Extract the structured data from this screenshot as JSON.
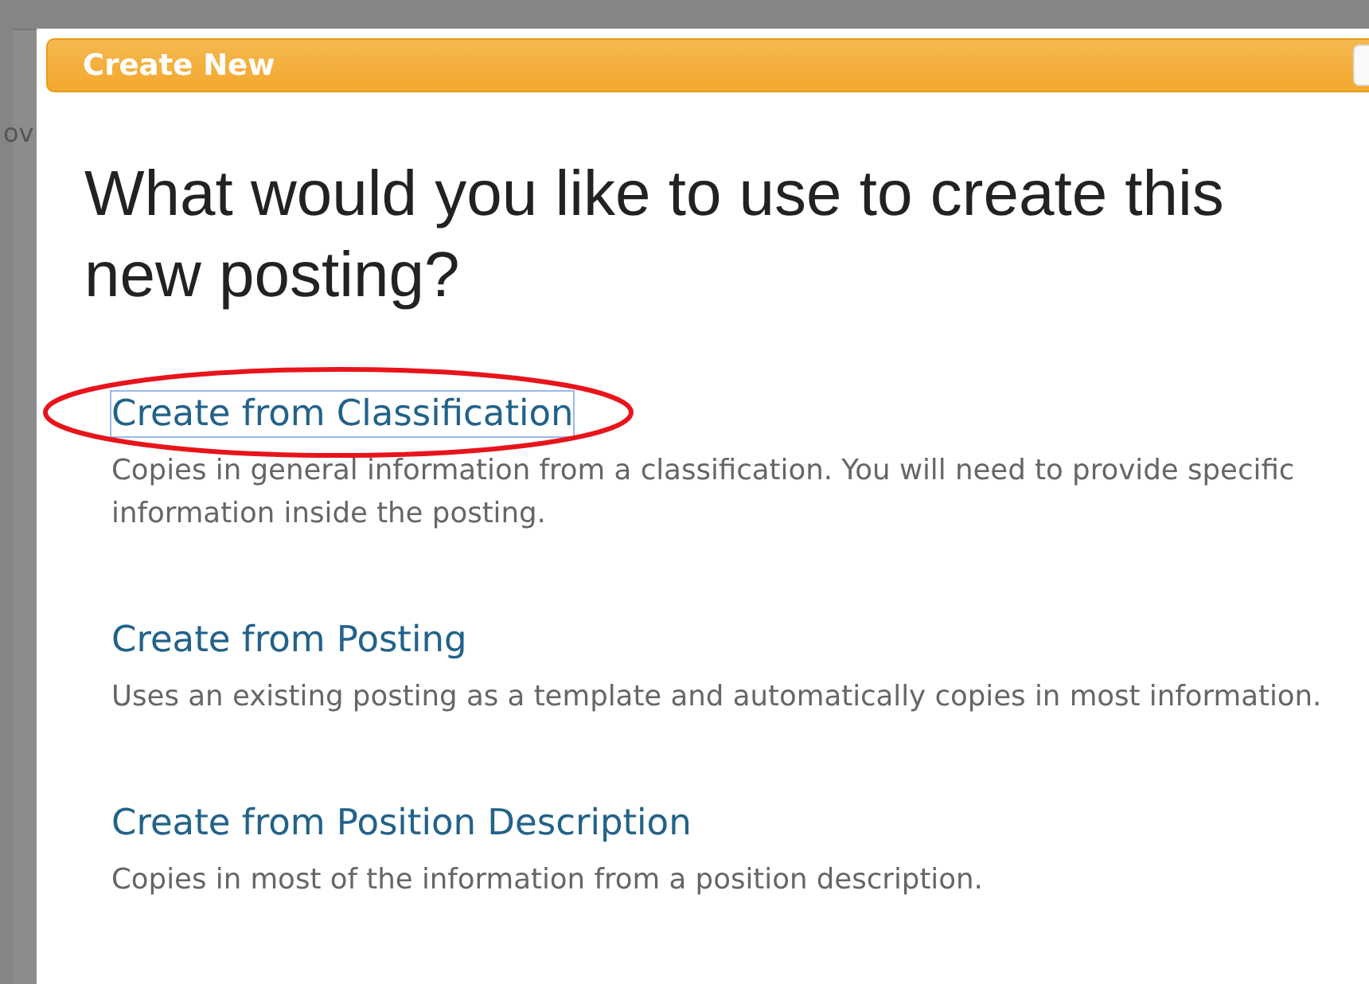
{
  "background": {
    "text": "ov"
  },
  "dialog": {
    "title": "Create New",
    "heading": "What would you like to use to create this new posting?",
    "options": [
      {
        "title": "Create from Classification",
        "description": "Copies in general information from a classification. You will need to provide specific information inside the posting.",
        "focused": true,
        "circled": true
      },
      {
        "title": "Create from Posting",
        "description": "Uses an existing posting as a template and automatically copies in most information.",
        "focused": false,
        "circled": false
      },
      {
        "title": "Create from Position Description",
        "description": "Copies in most of the information from a position description.",
        "focused": false,
        "circled": false
      }
    ]
  }
}
